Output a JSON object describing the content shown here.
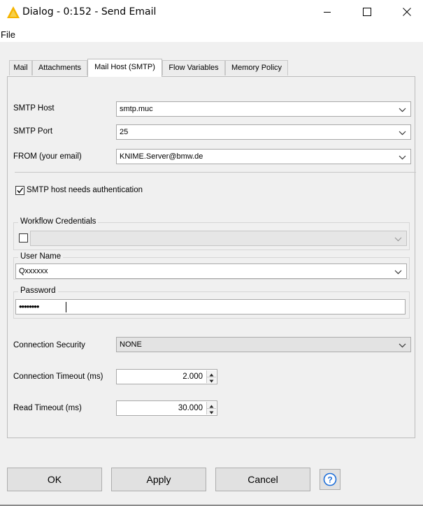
{
  "window": {
    "title": "Dialog - 0:152 - Send Email",
    "icon": "knime-warning-triangle-icon"
  },
  "menu": {
    "file": "File"
  },
  "tabs": [
    {
      "label": "Mail"
    },
    {
      "label": "Attachments"
    },
    {
      "label": "Mail Host (SMTP)",
      "active": true
    },
    {
      "label": "Flow Variables"
    },
    {
      "label": "Memory Policy"
    }
  ],
  "smtp": {
    "host_label": "SMTP Host",
    "host_value": "smtp.muc",
    "port_label": "SMTP Port",
    "port_value": "25",
    "from_label": "FROM (your email)",
    "from_value": "KNIME.Server@bmw.de"
  },
  "auth": {
    "checkbox_label": "SMTP host needs authentication",
    "checked": true,
    "workflow_credentials_title": "Workflow Credentials",
    "workflow_credentials_checked": false,
    "username_title": "User Name",
    "username_value": "Qxxxxxx",
    "password_title": "Password",
    "password_value": "••••••••"
  },
  "connection": {
    "security_label": "Connection Security",
    "security_value": "NONE",
    "timeout_label": "Connection Timeout (ms)",
    "timeout_value": "2.000",
    "read_timeout_label": "Read Timeout (ms)",
    "read_timeout_value": "30.000"
  },
  "buttons": {
    "ok": "OK",
    "apply": "Apply",
    "cancel": "Cancel",
    "help_icon": "question-circle-icon"
  },
  "colors": {
    "icon_yellow": "#f5b400",
    "help_blue": "#1e6fd9"
  }
}
